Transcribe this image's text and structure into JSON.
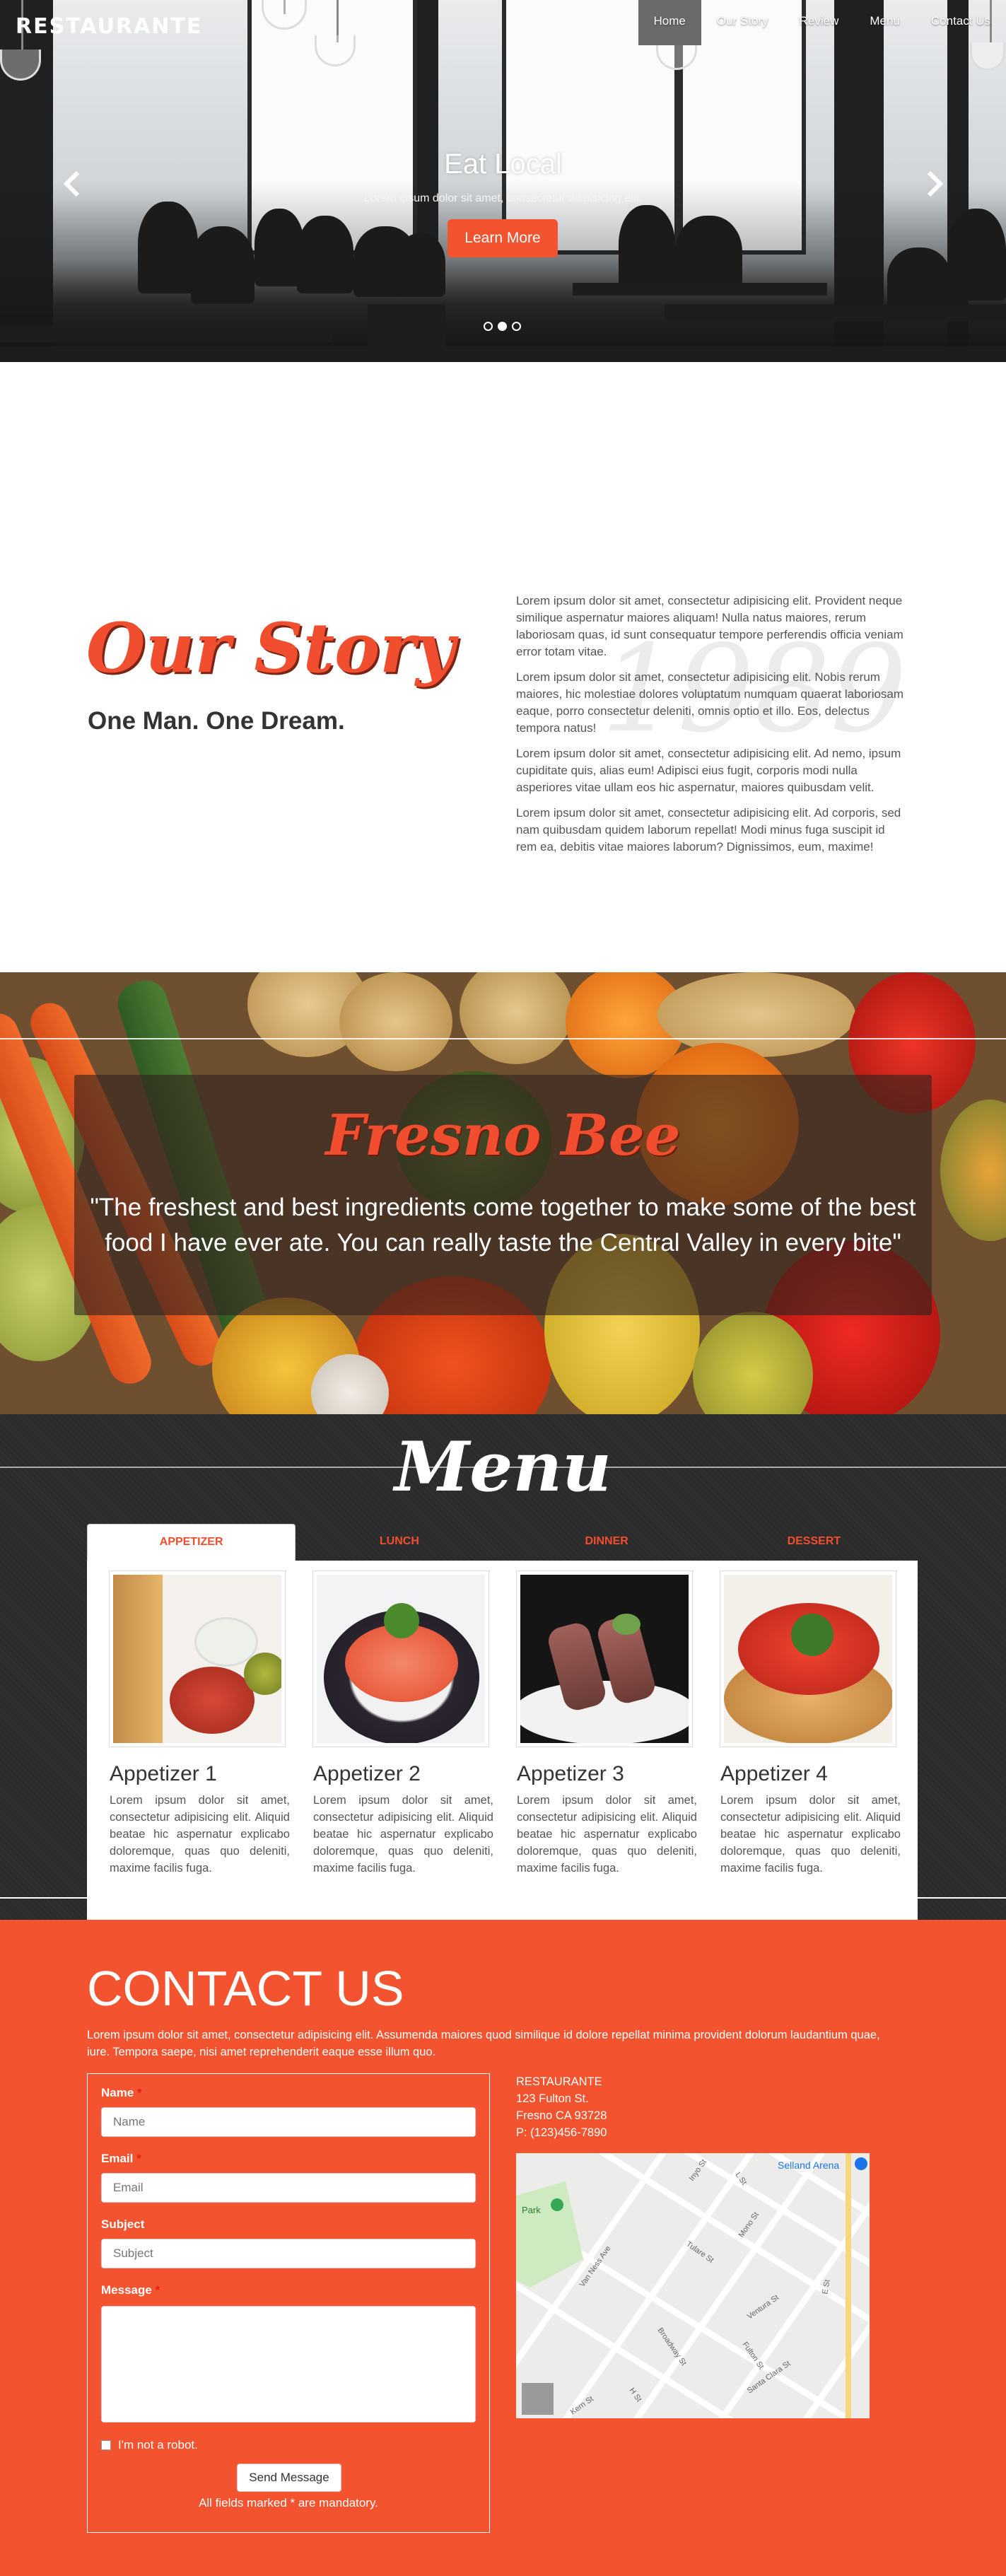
{
  "brand": "RESTAURANTE",
  "nav": [
    "Home",
    "Our Story",
    "Review",
    "Menu",
    "Contact Us"
  ],
  "hero": {
    "title": "Eat Local",
    "subtitle": "Lorem ipsum dolor sit amet, consectetur adipisicing elit.",
    "button": "Learn More",
    "prev_icon": "chevron-left-icon",
    "next_icon": "chevron-right-icon",
    "slide_count": 3,
    "active_slide": 2
  },
  "story": {
    "title": "Our Story",
    "subtitle": "One Man. One Dream.",
    "year": "1989",
    "paragraphs": [
      "Lorem ipsum dolor sit amet, consectetur adipisicing elit. Provident neque similique aspernatur maiores aliquam! Nulla natus maiores, rerum laboriosam quas, id sunt consequatur tempore perferendis officia veniam error totam vitae.",
      "Lorem ipsum dolor sit amet, consectetur adipisicing elit. Nobis rerum maiores, hic molestiae dolores voluptatum numquam quaerat laboriosam eaque, porro consectetur deleniti, omnis optio et illo. Eos, delectus tempora natus!",
      "Lorem ipsum dolor sit amet, consectetur adipisicing elit. Ad nemo, ipsum cupiditate quis, alias eum! Adipisci eius fugit, corporis modi nulla asperiores vitae ullam eos hic aspernatur, maiores quibusdam velit.",
      "Lorem ipsum dolor sit amet, consectetur adipisicing elit. Ad corporis, sed nam quibusdam quidem laborum repellat! Modi minus fuga suscipit id rem ea, debitis vitae maiores laborum? Dignissimos, eum, maxime!"
    ]
  },
  "review": {
    "title": "Fresno Bee",
    "quote": "\"The freshest and best ingredients come together to make some of the best food I have ever ate. You can really taste the Central Valley in every bite\""
  },
  "menu": {
    "title": "Menu",
    "tabs": [
      "APPETIZER",
      "LUNCH",
      "DINNER",
      "DESSERT"
    ],
    "active_tab": "APPETIZER",
    "items": [
      {
        "name": "Appetizer 1",
        "desc": "Lorem ipsum dolor sit amet, consectetur adipisicing elit. Aliquid beatae hic aspernatur explicabo doloremque, quas quo deleniti, maxime facilis fuga."
      },
      {
        "name": "Appetizer 2",
        "desc": "Lorem ipsum dolor sit amet, consectetur adipisicing elit. Aliquid beatae hic aspernatur explicabo doloremque, quas quo deleniti, maxime facilis fuga."
      },
      {
        "name": "Appetizer 3",
        "desc": "Lorem ipsum dolor sit amet, consectetur adipisicing elit. Aliquid beatae hic aspernatur explicabo doloremque, quas quo deleniti, maxime facilis fuga."
      },
      {
        "name": "Appetizer 4",
        "desc": "Lorem ipsum dolor sit amet, consectetur adipisicing elit. Aliquid beatae hic aspernatur explicabo doloremque, quas quo deleniti, maxime facilis fuga."
      }
    ]
  },
  "contact": {
    "title": "CONTACT US",
    "text": "Lorem ipsum dolor sit amet, consectetur adipisicing elit. Assumenda maiores quod similique id dolore repellat minima provident dolorum laudantium quae, iure. Tempora saepe, nisi amet reprehenderit eaque esse illum quo.",
    "fields": {
      "name_label": "Name",
      "name_placeholder": "Name",
      "email_label": "Email",
      "email_placeholder": "Email",
      "subject_label": "Subject",
      "subject_placeholder": "Subject",
      "message_label": "Message",
      "required_mark": "*"
    },
    "captcha": "I'm not a robot.",
    "send": "Send Message",
    "mandatory_note": "All fields marked * are mandatory.",
    "address": {
      "name": "RESTAURANTE",
      "street": "123 Fulton St.",
      "city": "Fresno CA 93728",
      "phone": "P: (123)456-7890"
    },
    "map": {
      "labels": [
        "Selland Arena",
        "Park",
        "Ventura St",
        "Broadway St",
        "Fulton St",
        "H St",
        "Santa Clara St",
        "Inyo St",
        "Mono St",
        "E St",
        "L St",
        "Van Ness Ave",
        "Kern St",
        "Tulare St"
      ],
      "park_color": "#cdeac0",
      "road_color": "#ffffff",
      "highway_color": "#f6d77f"
    }
  },
  "colors": {
    "accent": "#f4532f",
    "title_red": "#f04e2e",
    "menu_bg": "#2b2b2c"
  }
}
